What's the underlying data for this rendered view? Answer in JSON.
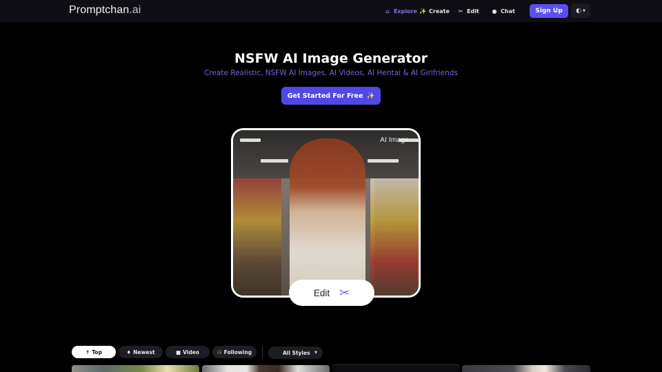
{
  "header": {
    "logo_main": "Promptchan",
    "logo_suffix": ".ai",
    "nav": [
      {
        "label": "Explore",
        "icon": "home-icon",
        "glyph": "⌂",
        "active": true
      },
      {
        "label": "Create",
        "icon": "magic-wand-icon",
        "glyph": "✨",
        "active": false
      },
      {
        "label": "Edit",
        "icon": "scissors-icon",
        "glyph": "✂",
        "active": false
      },
      {
        "label": "Chat",
        "icon": "chat-bubble-icon",
        "glyph": "●",
        "active": false
      }
    ],
    "signup_label": "Sign Up",
    "language_icon": "◐",
    "language_caret": "▼"
  },
  "hero": {
    "title": "NSFW AI Image Generator",
    "subtitle": "Create Realistic, NSFW AI Images, AI Videos, AI Hentai & AI Girlfriends",
    "cta_label": "Get Started For Free",
    "cta_icon": "✨",
    "image_label": "AI Image",
    "edit_label": "Edit",
    "edit_icon": "✂"
  },
  "filters": {
    "tabs": [
      {
        "label": "Top",
        "icon": "arrow-up-icon",
        "glyph": "↑",
        "active": true
      },
      {
        "label": "Newest",
        "icon": "flame-icon",
        "glyph": "♦",
        "active": false
      },
      {
        "label": "Video",
        "icon": "video-camera-icon",
        "glyph": "■",
        "active": false
      },
      {
        "label": "Following",
        "icon": "users-icon",
        "glyph": "⚇",
        "active": false
      }
    ],
    "styles_label": "All Styles",
    "styles_caret": "▼"
  },
  "colors": {
    "accent": "#5b4ff0",
    "accent_text": "#6f68e6",
    "topbar_bg": "#0f0e14",
    "page_bg": "#000000"
  }
}
